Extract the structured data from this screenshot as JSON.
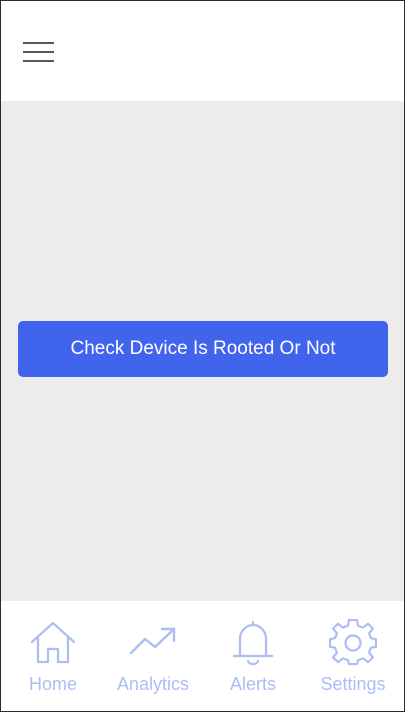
{
  "header": {
    "menu_icon": "hamburger-menu-icon"
  },
  "main": {
    "check_button_label": "Check Device Is Rooted Or Not"
  },
  "tabs": [
    {
      "label": "Home",
      "icon": "home-icon"
    },
    {
      "label": "Analytics",
      "icon": "trending-up-icon"
    },
    {
      "label": "Alerts",
      "icon": "bell-icon"
    },
    {
      "label": "Settings",
      "icon": "gear-icon"
    }
  ],
  "colors": {
    "accent": "#4164ec",
    "tab_inactive": "#aebcf5",
    "content_background": "#ececec",
    "bar_background": "#ffffff"
  }
}
